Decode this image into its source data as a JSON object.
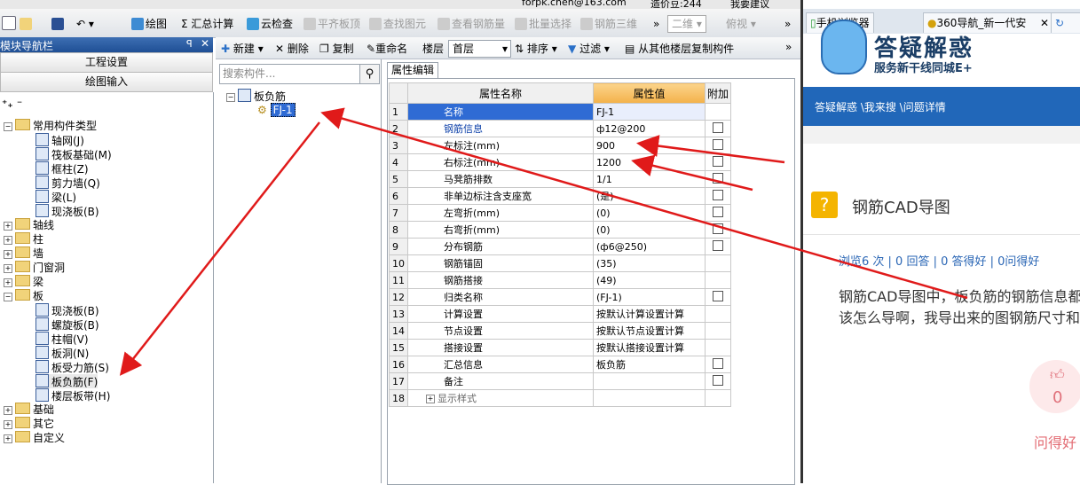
{
  "sysbar": {
    "email": "forpk.chen@163.com",
    "points": "造价豆:244",
    "suggest": "我要建议"
  },
  "toolbar": {
    "items": [
      "绘图",
      "Σ 汇总计算",
      "云检查",
      "平齐板顶",
      "查找图元",
      "查看钢筋量",
      "批量选择",
      "钢筋三维",
      "二维",
      "俯视"
    ]
  },
  "nav": {
    "title": "模块导航栏",
    "project_settings": "工程设置",
    "drawing_input": "绘图输入",
    "tree": [
      {
        "label": "常用构件类型",
        "type": "folder",
        "open": true
      },
      {
        "label": "轴网(J)",
        "type": "leaf"
      },
      {
        "label": "筏板基础(M)",
        "type": "leaf"
      },
      {
        "label": "框柱(Z)",
        "type": "leaf"
      },
      {
        "label": "剪力墙(Q)",
        "type": "leaf"
      },
      {
        "label": "梁(L)",
        "type": "leaf"
      },
      {
        "label": "现浇板(B)",
        "type": "leaf"
      },
      {
        "label": "轴线",
        "type": "folder"
      },
      {
        "label": "柱",
        "type": "folder"
      },
      {
        "label": "墙",
        "type": "folder"
      },
      {
        "label": "门窗洞",
        "type": "folder"
      },
      {
        "label": "梁",
        "type": "folder"
      },
      {
        "label": "板",
        "type": "folder",
        "open": true
      },
      {
        "label": "现浇板(B)",
        "type": "leaf"
      },
      {
        "label": "螺旋板(B)",
        "type": "leaf"
      },
      {
        "label": "柱帽(V)",
        "type": "leaf"
      },
      {
        "label": "板洞(N)",
        "type": "leaf"
      },
      {
        "label": "板受力筋(S)",
        "type": "leaf"
      },
      {
        "label": "板负筋(F)",
        "type": "leaf",
        "selected": true
      },
      {
        "label": "楼层板带(H)",
        "type": "leaf"
      },
      {
        "label": "基础",
        "type": "folder"
      },
      {
        "label": "其它",
        "type": "folder"
      },
      {
        "label": "自定义",
        "type": "folder"
      }
    ]
  },
  "toolbar2": {
    "new": "新建",
    "delete": "删除",
    "copy": "复制",
    "rename": "重命名",
    "floor_label": "楼层",
    "floor_value": "首层",
    "sort": "排序",
    "filter": "过滤",
    "copy_from_floor": "从其他楼层复制构件"
  },
  "components": {
    "search_placeholder": "搜索构件...",
    "root": "板负筋",
    "child": "FJ-1"
  },
  "props": {
    "tab": "属性编辑",
    "headers": {
      "name": "属性名称",
      "value": "属性值",
      "extra": "附加"
    },
    "rows": [
      {
        "n": "1",
        "name": "名称",
        "value": "FJ-1",
        "blue": true,
        "cb": false
      },
      {
        "n": "2",
        "name": "钢筋信息",
        "value": "ф12@200",
        "blue": true,
        "cb": true
      },
      {
        "n": "3",
        "name": "左标注(mm)",
        "value": "900",
        "blue": false,
        "cb": true
      },
      {
        "n": "4",
        "name": "右标注(mm)",
        "value": "1200",
        "blue": false,
        "cb": true
      },
      {
        "n": "5",
        "name": "马凳筋排数",
        "value": "1/1",
        "blue": false,
        "cb": true
      },
      {
        "n": "6",
        "name": "非单边标注含支座宽",
        "value": "(是)",
        "blue": false,
        "cb": true
      },
      {
        "n": "7",
        "name": "左弯折(mm)",
        "value": "(0)",
        "blue": false,
        "cb": true
      },
      {
        "n": "8",
        "name": "右弯折(mm)",
        "value": "(0)",
        "blue": false,
        "cb": true
      },
      {
        "n": "9",
        "name": "分布钢筋",
        "value": "(ф6@250)",
        "blue": false,
        "cb": true
      },
      {
        "n": "10",
        "name": "钢筋锚固",
        "value": "(35)",
        "blue": false,
        "cb": false
      },
      {
        "n": "11",
        "name": "钢筋搭接",
        "value": "(49)",
        "blue": false,
        "cb": false
      },
      {
        "n": "12",
        "name": "归类名称",
        "value": "(FJ-1)",
        "blue": false,
        "cb": true
      },
      {
        "n": "13",
        "name": "计算设置",
        "value": "按默认计算设置计算",
        "blue": false,
        "cb": false
      },
      {
        "n": "14",
        "name": "节点设置",
        "value": "按默认节点设置计算",
        "blue": false,
        "cb": false
      },
      {
        "n": "15",
        "name": "搭接设置",
        "value": "按默认搭接设置计算",
        "blue": false,
        "cb": false
      },
      {
        "n": "16",
        "name": "汇总信息",
        "value": "板负筋",
        "blue": false,
        "cb": true
      },
      {
        "n": "17",
        "name": "备注",
        "value": "",
        "blue": false,
        "cb": true
      },
      {
        "n": "18",
        "name": "显示样式",
        "value": "",
        "blue": false,
        "cb": false
      }
    ]
  },
  "browser": {
    "tab1": "手机浏览器",
    "tab2": "360导航_新一代安",
    "banner_title": "答疑解惑",
    "banner_sub": "服务新干线同城E+",
    "nav_text": "答疑解惑 \\我来搜 \\问题详情",
    "question_title": "钢筋CAD导图",
    "stats": "浏览6 次 | 0 回答 | 0 答得好 | 0问得好",
    "body1": "钢筋CAD导图中，板负筋的钢筋信息都",
    "body2": "该怎么导啊，我导出来的图钢筋尺寸和",
    "like_count": "0",
    "like_label": "问得好"
  },
  "colors": {
    "accent_blue": "#2167b9",
    "header_orange": "#f3b14a",
    "arrow_red": "#e01a1a"
  }
}
